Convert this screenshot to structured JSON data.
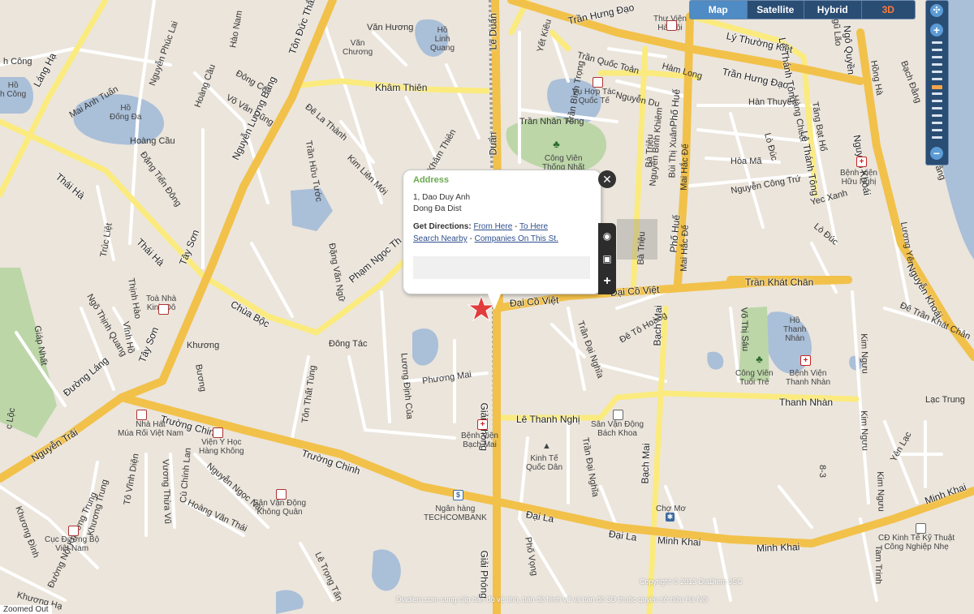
{
  "map_type": {
    "buttons": [
      {
        "label": "Map",
        "active": true
      },
      {
        "label": "Satellite",
        "active": false
      },
      {
        "label": "Hybrid",
        "active": false
      },
      {
        "label": "3D",
        "active": false
      }
    ]
  },
  "zoom": {
    "in_label": "+",
    "out_label": "−",
    "fullscreen_icon": "compass-icon",
    "level": 0.55
  },
  "popup": {
    "title": "Address",
    "address_line1": "1, Dao Duy Anh",
    "address_line2": "Dong Đa Dist",
    "directions_label": "Get Directions:",
    "from_here": "From Here",
    "sep1": "-",
    "to_here": "To Here",
    "search_nearby": "Search Nearby",
    "sep2": "-",
    "companies": "Companies On This St.",
    "close_label": "✕"
  },
  "roads": {
    "tran_hung_dao_1": "Trần Hưng Đạo",
    "tran_hung_dao_2": "Trần Hưng Đạo",
    "ly_thuong_kiet": "Lý Thường Kiệt",
    "kham_thien": "Khâm Thiên",
    "van_huong": "Văn Hương",
    "ton_duc_thang": "Tôn Đức Thắng",
    "lang_ha": "Láng Hạ",
    "thanh_cong": "h Công",
    "nguyen_phuc_lai": "Nguyễn Phúc Lai",
    "hao_nam": "Hào Nam",
    "hoang_cau": "Hoàng Cầu",
    "dong_cac": "Đông Các",
    "vo_van_dung": "Võ Văn Dũng",
    "mai_anh_tuan": "Mai Anh Tuấn",
    "hoang_cau_2": "Hoàng Cầu",
    "dang_tien_dong": "Đặng Tiến Đông",
    "thai_ha": "Thái Hà",
    "thai_ha_2": "Thái Hà",
    "nguyen_luong_bang": "Nguyễn Lương Bằng",
    "de_la_thanh": "Đê La Thành",
    "tran_huu_tuoc": "Trần Hữu Tước",
    "kim_lien_moi": "Kim Liên Mới",
    "kham_thien_2": "Khâm Thiên",
    "tay_son": "Tây Sơn",
    "tay_son_2": "Tây Sơn",
    "chua_boc": "Chùa Bộc",
    "pham_ngoc_thach": "Phạm Ngọc Th",
    "dong_tac": "Đông Tác",
    "dang_van_ngu": "Đặng Văn Ngữ",
    "luong_dinh_cua": "Lương Định Của",
    "phuong_mai": "Phương Mai",
    "ton_that_tung": "Tôn Thất Tùng",
    "truong_chinh": "Trường Chinh",
    "truong_chinh_2": "Trường Chinh",
    "nguyen_trai": "Nguyễn Trãi",
    "duong_lang": "Đường Láng",
    "giai_phong": "Giải Phóng",
    "giai_phong_2": "Giải Phóng",
    "le_duan": "Lê Duẩn",
    "le_duan_2": "Duẩn",
    "yet_kieu": "Yết Kiêu",
    "tran_binh_trong": "Trần Bình Trọng",
    "tran_quoc_toan": "Trần Quốc Toản",
    "ham_long": "Hàm Long",
    "nguyen_du": "Nguyễn Du",
    "tran_nhan_tong": "Trần Nhân Tông",
    "han_thuyen": "Hàn Thuyên",
    "hang_chuoi": "Hàng Chuối",
    "tang_bat_ho": "Tăng Bạt Hổ",
    "le_thanh_tong": "Lê Thánh Tông",
    "le_thanh_tong_2": "Lê Thánh Tông",
    "hoa_ma": "Hòa Mã",
    "lo_duc": "Lò Đúc",
    "lo_duc_2": "Lò Đúc",
    "nguyen_cong_tru": "Nguyễn Công Trứ",
    "yec_xanh": "Yec Xanh",
    "ba_trieu": "Bà Triệu",
    "ba_trieu_2": "Bà Triệu",
    "bui_thi_xuan": "Bùi Thị Xuân",
    "mai_hac_de": "Mai Hắc Đế",
    "mai_hac_de_2": "Mai Hắc Đế",
    "pho_hue": "Phố Huế",
    "pho_hue_2": "Phố Huế",
    "nguyen_binh_khiem": "Nguyễn Bỉnh Khiêm",
    "dai_co_viet": "Đại Cồ Việt",
    "dai_co_viet_2": "Đại Cồ Việt",
    "tran_khat_chan": "Trần Khát Chân",
    "de_to_hoang": "Đê Tô Hoàng",
    "tran_dai_nghia": "Trần Đại Nghĩa",
    "tran_dai_nghia_2": "Trần Đại Nghĩa",
    "bach_mai": "Bạch Mai",
    "bach_mai_2": "Bạch Mai",
    "le_thanh_nghi": "Lê Thanh Nghị",
    "thanh_nhan": "Thanh Nhàn",
    "vo_thi_sau": "Võ Thị Sáu",
    "kim_nguu": "Kim Ngưu",
    "kim_nguu_2": "Kim Ngưu",
    "kim_nguu_3": "Kim Ngưu",
    "lac_trung": "Lạc Trung",
    "yen_lac": "Yên Lạc",
    "de_tran_khat_chan": "Đê Trần Khát Chân",
    "luong_yen": "Lương Yên",
    "nguyen_khoai": "Nguyễn Khoái",
    "nguyen_khoai_2": "Nguyễn Khoái",
    "hong_ha": "Hồng Hà",
    "bach_dang": "Bạch Đằng",
    "bach_dang_2": "Bạch Đằng",
    "ngo_quyen": "Ngô Quyền",
    "ngu_lao": "Ngũ Lão",
    "dai_la": "Đại La",
    "dai_la_2": "Đại La",
    "minh_khai": "Minh Khai",
    "minh_khai_2": "Minh Khai",
    "minh_khai_3": "Minh Khai",
    "le_trong_tan": "Lê Trọng Tấn",
    "hoang_van_thai": "Hoàng Văn Thái",
    "nguyen_ngoc_nai": "Nguyễn Ngọc Nại",
    "vuong_thua_vu": "Vương Thừa Vũ",
    "cu_chinh_lan": "Cù Chính Lan",
    "to_vinh_dien": "Tô Vĩnh Diện",
    "khuong_trung": "Khương Trung",
    "khuong_dinh": "Khương Đình",
    "khuong_ha": "Khương Hạ",
    "duong_noi_khuong_trung": "Đường Nội Khương Trung",
    "khuong_thuong": "Khương",
    "buong": "Bương",
    "ngo_thinh_quang": "Ngõ Thịnh Quang",
    "thinh_hao": "Thịnh Hào",
    "vinh_ho": "Vĩnh Hồ",
    "tong_liet": "Trúc Liệt",
    "giap_nhat": "Giáp Nhất",
    "pho_vong": "Phố Vọng",
    "lac_loc": "c Lộc",
    "kham_thien_3": "Khâm Thiên",
    "tam_trinh": "Tam Trinh",
    "pho_8_3": "8-3",
    "le_van_huu": "Le Van Huu"
  },
  "pois": {
    "thu_vien": "Thư Viện\nHà Nội",
    "van_chuong": "Văn\nChương",
    "ho_linh_quang": "Hồ\nLinh\nQuang",
    "vu_hop_tac": "Vụ Hợp Tác\nQuốc Tế",
    "cong_vien_thong_nhat": "Công Viên\nThống Nhất",
    "ho_dong_da": "Hồ\nĐống Đa",
    "ho_left": "Hồ\nh Công",
    "toa_nha": "Toà Nhà\nKinh Đô",
    "benh_vien_bach_mai": "Bệnh Viện\nBạch Mai",
    "kinh_te_qd": "Kinh Tế\nQuốc Dân",
    "svd_bach_khoa": "Sân Vận Động\nBách Khoa",
    "nha_hat": "Nhà Hát\nMúa Rối Việt Nam",
    "vien_y_hoc": "Viện Y Học\nHàng Không",
    "svd_khong_quan": "Sân Vận Động\nKhông Quân",
    "cuc_duong_bo": "Cục Đường Bộ\nViệt Nam",
    "techcombank": "Ngân hàng\nTECHCOMBANK",
    "cho_mo": "Chợ Mơ",
    "ho_thanh_nhan": "Hồ\nThanh\nNhàn",
    "cv_tuoi_tre": "Công Viên\nTuổi Trẻ",
    "bv_thanh_nhan": "Bệnh Viện\nThanh Nhàn",
    "bv_huu_nghi": "Bệnh Viện\nHữu Nghị",
    "cd_kinh_te": "CĐ Kinh Tế Kỹ Thuật\nCông Nghiệp Nhẹ"
  },
  "footer": {
    "copyright": "Copyright © 2013 DiaDiem JSC",
    "note": "Diadiem.com cung cấp bản đồ vệ tinh, bản đồ hình vẽ và bản đồ 3D thuộc quyền sở hữu Hà Nội",
    "left_badge": "Zoomed Out"
  },
  "colors": {
    "background": "#ebe5dc",
    "block": "#f4f1eb",
    "major_road": "#f2c14a",
    "secondary_road": "#fbeb7e",
    "minor_road": "#ffffff",
    "water": "#aabfd8",
    "park": "#bcd6a8",
    "marker": "#e23b3b",
    "accent": "#2a4d74"
  }
}
